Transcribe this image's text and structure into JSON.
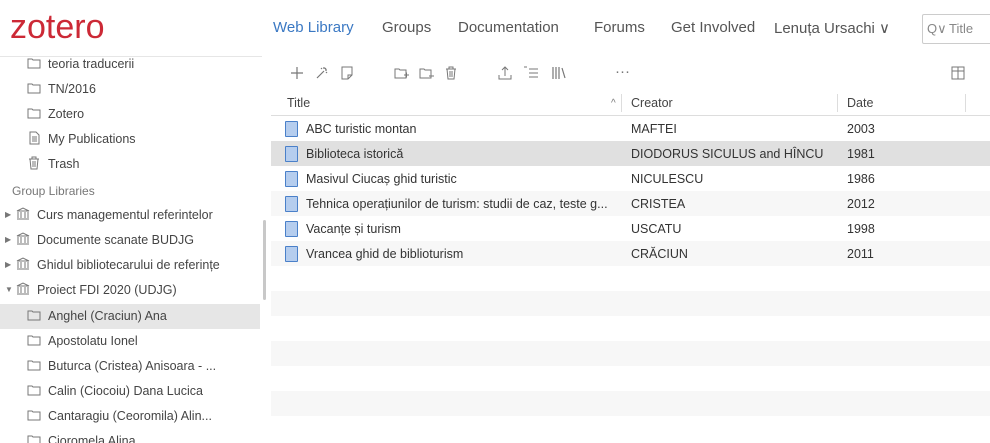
{
  "brand": {
    "logo": "zotero"
  },
  "nav": {
    "items": [
      "Web Library",
      "Groups",
      "Documentation",
      "Forums",
      "Get Involved",
      "Lenuța Ursachi ∨"
    ]
  },
  "search": {
    "icon_label": "Q∨",
    "placeholder": "Title"
  },
  "sidebar": {
    "top_items": [
      {
        "label": "teoria traducerii"
      },
      {
        "label": "TN/2016"
      },
      {
        "label": "Zotero"
      },
      {
        "label": "My Publications"
      },
      {
        "label": "Trash"
      }
    ],
    "group_header": "Group Libraries",
    "groups": [
      {
        "label": "Curs managementul referintelor"
      },
      {
        "label": "Documente scanate BUDJG"
      },
      {
        "label": "Ghidul bibliotecarului de referințe"
      },
      {
        "label": "Proiect FDI 2020 (UDJG)"
      }
    ],
    "subitems": [
      {
        "label": "Anghel (Craciun) Ana"
      },
      {
        "label": "Apostolatu Ionel"
      },
      {
        "label": "Buturca (Cristea) Anisoara - ..."
      },
      {
        "label": "Calin (Ciocoiu) Dana Lucica"
      },
      {
        "label": "Cantaragiu (Ceoromila) Alin..."
      },
      {
        "label": "Cioromela Alina"
      }
    ]
  },
  "toolbar": {
    "more": "···"
  },
  "table": {
    "headers": {
      "title": "Title",
      "sort": "^",
      "creator": "Creator",
      "date": "Date"
    },
    "rows": [
      {
        "title": "ABC turistic montan",
        "creator": "MAFTEI",
        "date": "2003"
      },
      {
        "title": "Biblioteca istorică",
        "creator": "DIODORUS SICULUS and HÎNCU",
        "date": "1981"
      },
      {
        "title": "Masivul Ciucaș ghid turistic",
        "creator": "NICULESCU",
        "date": "1986"
      },
      {
        "title": "Tehnica operațiunilor de turism: studii de caz, teste g...",
        "creator": "CRISTEA",
        "date": "2012"
      },
      {
        "title": "Vacanțe și turism",
        "creator": "USCATU",
        "date": "1998"
      },
      {
        "title": "Vrancea ghid de biblioturism",
        "creator": "CRĂCIUN",
        "date": "2011"
      }
    ]
  },
  "colors": {
    "brand": "#cc2936",
    "link": "#3a78c3",
    "selected": "#e0e0e0"
  }
}
